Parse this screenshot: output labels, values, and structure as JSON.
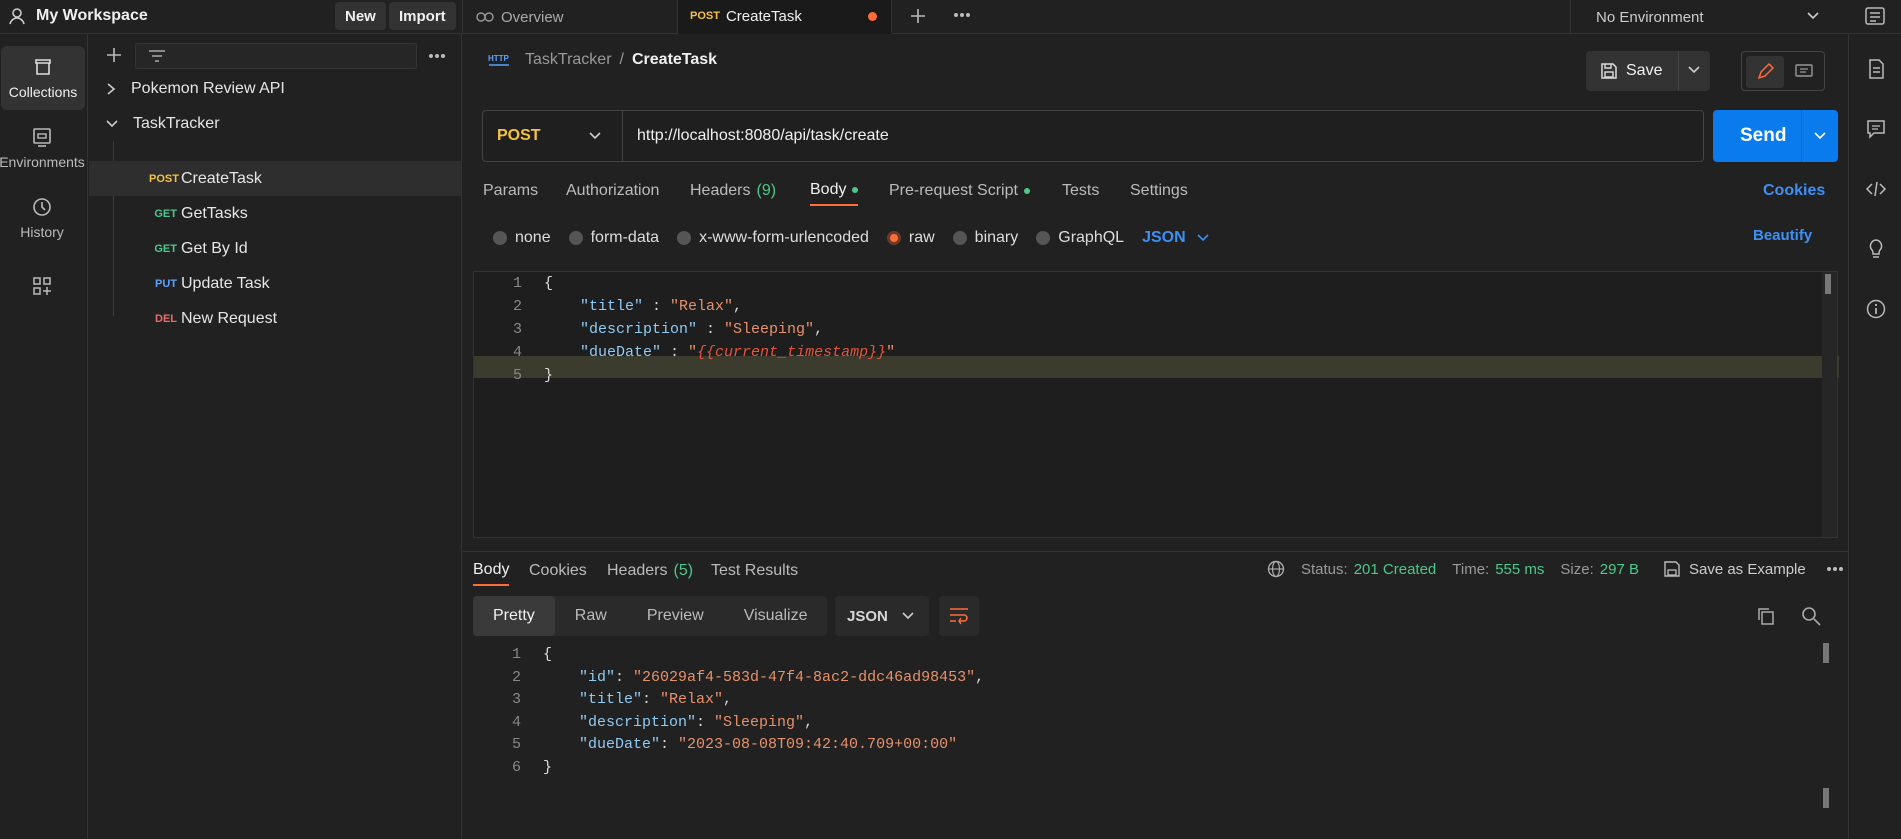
{
  "workspace": {
    "name": "My Workspace",
    "new_label": "New",
    "import_label": "Import"
  },
  "tabs": [
    {
      "label": "Overview",
      "icon": "overview-icon"
    },
    {
      "method": "POST",
      "label": "CreateTask",
      "unsaved": true
    }
  ],
  "environment": {
    "selected": "No Environment"
  },
  "rail": {
    "items": [
      {
        "label": "Collections",
        "icon": "collections-icon"
      },
      {
        "label": "Environments",
        "icon": "environments-icon"
      },
      {
        "label": "History",
        "icon": "history-icon"
      },
      {
        "label": "",
        "icon": "apps-icon"
      }
    ]
  },
  "sidebar": {
    "collections": [
      {
        "name": "Pokemon Review API",
        "expanded": false
      },
      {
        "name": "TaskTracker",
        "expanded": true
      }
    ],
    "requests": [
      {
        "method": "POST",
        "name": "CreateTask"
      },
      {
        "method": "GET",
        "name": "GetTasks"
      },
      {
        "method": "GET",
        "name": "Get By Id"
      },
      {
        "method": "PUT",
        "name": "Update Task"
      },
      {
        "method": "DEL",
        "name": "New Request"
      }
    ]
  },
  "request": {
    "breadcrumb_parent": "TaskTracker",
    "breadcrumb_sep": "/",
    "title": "CreateTask",
    "save_label": "Save",
    "method": "POST",
    "url": "http://localhost:8080/api/task/create",
    "send_label": "Send",
    "tabs": {
      "params": "Params",
      "authorization": "Authorization",
      "headers": "Headers",
      "headers_count": "(9)",
      "body": "Body",
      "prerequest": "Pre-request Script",
      "tests": "Tests",
      "settings": "Settings",
      "cookies": "Cookies"
    },
    "body_types": [
      "none",
      "form-data",
      "x-www-form-urlencoded",
      "raw",
      "binary",
      "GraphQL"
    ],
    "body_format": "JSON",
    "beautify_label": "Beautify",
    "body_lines": [
      "1",
      "2",
      "3",
      "4",
      "5"
    ],
    "body": {
      "open": "{",
      "title_key": "\"title\"",
      "title_val": "\"Relax\"",
      "desc_key": "\"description\"",
      "desc_val": "\"Sleeping\"",
      "due_key": "\"dueDate\"",
      "due_val": "{{current_timestamp}}",
      "close": "}"
    }
  },
  "response": {
    "tabs": {
      "body": "Body",
      "cookies": "Cookies",
      "headers": "Headers",
      "headers_count": "(5)",
      "tests": "Test Results"
    },
    "status_label": "Status:",
    "status_value": "201 Created",
    "time_label": "Time:",
    "time_value": "555 ms",
    "size_label": "Size:",
    "size_value": "297 B",
    "save_example_label": "Save as Example",
    "view_tabs": [
      "Pretty",
      "Raw",
      "Preview",
      "Visualize"
    ],
    "format": "JSON",
    "lines": [
      "1",
      "2",
      "3",
      "4",
      "5",
      "6"
    ],
    "body": {
      "open": "{",
      "id_key": "\"id\"",
      "id_val": "\"26029af4-583d-47f4-8ac2-ddc46ad98453\"",
      "title_key": "\"title\"",
      "title_val": "\"Relax\"",
      "desc_key": "\"description\"",
      "desc_val": "\"Sleeping\"",
      "due_key": "\"dueDate\"",
      "due_val": "\"2023-08-08T09:42:40.709+00:00\"",
      "close": "}"
    }
  },
  "colors": {
    "accent": "#ff6c37",
    "send": "#097bed",
    "success": "#4ec88a",
    "link": "#3d8ff5"
  }
}
